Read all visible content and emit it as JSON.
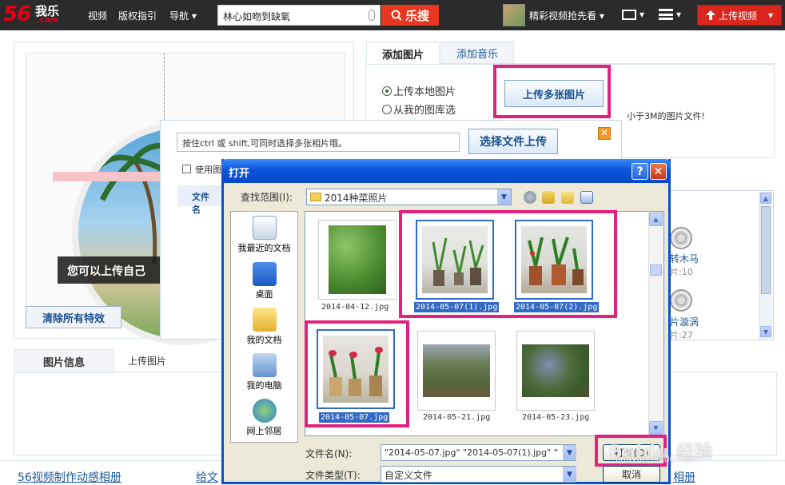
{
  "topbar": {
    "logo_num": "56",
    "logo_cn": "我乐",
    "logo_com": ".com",
    "nav": [
      "视频",
      "版权指引",
      "导航 ▾"
    ],
    "search_value": "林心如吻到缺氧",
    "search_button": "乐搜",
    "user_name": "精彩视频抢先看 ▾",
    "mail_arrow": "▾",
    "menu_arrow": "▾",
    "upload_video": "上传视频",
    "upload_arrow": "▾"
  },
  "left_panel": {
    "overlay_text": "您可以上传自己",
    "clear_effects": "清除所有特效"
  },
  "right_panel": {
    "tabs": [
      "添加图片",
      "添加音乐"
    ],
    "radio_local": "上传本地图片",
    "radio_library": "从我的图库选",
    "upload_multi": "上传多张图片",
    "size_note": "小于3M的图片文件!"
  },
  "upload_panel": {
    "hint": "按住ctrl 或 shift,可同时选择多张相片哦。",
    "select_upload": "选择文件上传",
    "close_glyph": "✕",
    "use_label": "使用图",
    "file_col": "文件名"
  },
  "effects": [
    {
      "label": "转木马",
      "count": "片:10"
    },
    {
      "label": "片漩涡",
      "count": "片:27"
    }
  ],
  "info_tabs": {
    "picture_info": "图片信息",
    "upload_pic": "上传图片"
  },
  "bottom_links": [
    "56视频制作动感相册",
    "给文",
    "相册"
  ],
  "dialog": {
    "title": "打开",
    "help": "?",
    "close": "✕",
    "lookin_label": "查找范围(I):",
    "lookin_value": "2014种菜照片",
    "places": [
      "我最近的文档",
      "桌面",
      "我的文档",
      "我的电脑",
      "网上邻居"
    ],
    "files": [
      {
        "name": "2014-04-12.jpg",
        "selected": false
      },
      {
        "name": "2014-05-07(1).jpg",
        "selected": true
      },
      {
        "name": "2014-05-07(2).jpg",
        "selected": true
      },
      {
        "name": "2014-05-07.jpg",
        "selected": true
      },
      {
        "name": "2014-05-21.jpg",
        "selected": false
      },
      {
        "name": "2014-05-23.jpg",
        "selected": false
      }
    ],
    "filename_label": "文件名(N):",
    "filename_value": "\"2014-05-07.jpg\" \"2014-05-07(1).jpg\" \"",
    "filetype_label": "文件类型(T):",
    "filetype_value": "自定义文件",
    "open_button": "打开(O)",
    "cancel_button": "取消"
  },
  "watermark": {
    "main": "Baidu 经验",
    "sub": "jingyan.baidu.com"
  },
  "colors": {
    "highlight": "#e3217f",
    "xp_title": "#0a55db",
    "selection": "#316ac5",
    "brand_red": "#e60012"
  }
}
